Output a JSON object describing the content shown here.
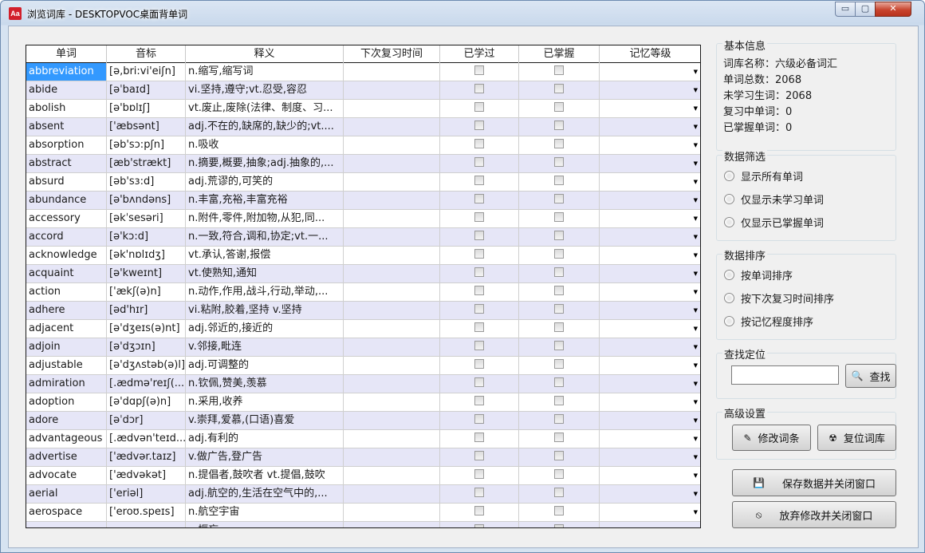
{
  "window": {
    "icon_text": "Aa",
    "title": "浏览词库 - DESKTOPVOC桌面背单词",
    "min_label": "▭",
    "max_label": "▢",
    "close_label": "✕"
  },
  "grid": {
    "columns": [
      "单词",
      "音标",
      "释义",
      "下次复习时间",
      "已学过",
      "已掌握",
      "记忆等级"
    ],
    "rows": [
      {
        "word": "abbreviation",
        "phonetic": "[ə,bri:vi'eiʃn]",
        "meaning": "n.缩写,缩写词"
      },
      {
        "word": "abide",
        "phonetic": "[əˈbaɪd]",
        "meaning": "vi.坚持,遵守;vt.忍受,容忍"
      },
      {
        "word": "abolish",
        "phonetic": "[ə'bɒlɪʃ]",
        "meaning": "vt.废止,废除(法律、制度、习..."
      },
      {
        "word": "absent",
        "phonetic": "['æbsənt]",
        "meaning": "adj.不在的,缺席的,缺少的;vt...."
      },
      {
        "word": "absorption",
        "phonetic": "[əb'sɔ:pʃn]",
        "meaning": "n.吸收"
      },
      {
        "word": "abstract",
        "phonetic": "[æb'strækt]",
        "meaning": "n.摘要,概要,抽象;adj.抽象的,..."
      },
      {
        "word": "absurd",
        "phonetic": "[əb'sɜ:d]",
        "meaning": "adj.荒谬的,可笑的"
      },
      {
        "word": "abundance",
        "phonetic": "[ə'bʌndəns]",
        "meaning": "n.丰富,充裕,丰富充裕"
      },
      {
        "word": "accessory",
        "phonetic": "[əkˈsesəri]",
        "meaning": "n.附件,零件,附加物,从犯,同..."
      },
      {
        "word": "accord",
        "phonetic": "[ə'kɔ:d]",
        "meaning": "n.一致,符合,调和,协定;vt.一..."
      },
      {
        "word": "acknowledge",
        "phonetic": "[ək'nɒlɪdʒ]",
        "meaning": "vt.承认,答谢,报偿"
      },
      {
        "word": "acquaint",
        "phonetic": "[ə'kweɪnt]",
        "meaning": "vt.使熟知,通知"
      },
      {
        "word": "action",
        "phonetic": "['ækʃ(ə)n]",
        "meaning": "n.动作,作用,战斗,行动,举动,..."
      },
      {
        "word": "adhere",
        "phonetic": "[əd'hɪr]",
        "meaning": "vi.粘附,胶着,坚持 v.坚持"
      },
      {
        "word": "adjacent",
        "phonetic": "[ə'dʒeɪs(ə)nt]",
        "meaning": "adj.邻近的,接近的"
      },
      {
        "word": "adjoin",
        "phonetic": "[ə'dʒɔɪn]",
        "meaning": "v.邻接,毗连"
      },
      {
        "word": "adjustable",
        "phonetic": "[ə'dʒʌstəb(ə)l]",
        "meaning": "adj.可调整的"
      },
      {
        "word": "admiration",
        "phonetic": "[.ædmə'reɪʃ(...",
        "meaning": "n.钦佩,赞美,羡慕"
      },
      {
        "word": "adoption",
        "phonetic": "[ə'dɑpʃ(ə)n]",
        "meaning": "n.采用,收养"
      },
      {
        "word": "adore",
        "phonetic": "[əˈdɔr]",
        "meaning": "v.崇拜,爱慕,(口语)喜爱"
      },
      {
        "word": "advantageous",
        "phonetic": "[.ædvən'teɪd...",
        "meaning": "adj.有利的"
      },
      {
        "word": "advertise",
        "phonetic": "['ædvər.taɪz]",
        "meaning": "v.做广告,登广告"
      },
      {
        "word": "advocate",
        "phonetic": "['ædvəkət]",
        "meaning": "n.提倡者,鼓吹者 vt.提倡,鼓吹"
      },
      {
        "word": "aerial",
        "phonetic": "['eriəl]",
        "meaning": "adj.航空的,生活在空气中的,..."
      },
      {
        "word": "aerospace",
        "phonetic": "['eroʊ.speɪs]",
        "meaning": "n.航空宇宙"
      },
      {
        "word": "",
        "phonetic": "",
        "meaning": "...振忘 ..."
      }
    ],
    "dropdown_glyph": "▼"
  },
  "basic_info": {
    "title": "基本信息",
    "lines": [
      "词库名称：六级必备词汇",
      "单词总数：2068",
      "未学习生词：2068",
      "复习中单词：0",
      "已掌握单词：0"
    ]
  },
  "filter": {
    "title": "数据筛选",
    "options": [
      "显示所有单词",
      "仅显示未学习单词",
      "仅显示已掌握单词"
    ]
  },
  "sort": {
    "title": "数据排序",
    "options": [
      "按单词排序",
      "按下次复习时间排序",
      "按记忆程度排序"
    ]
  },
  "search": {
    "title": "查找定位",
    "value": "",
    "button_label": "查找",
    "icon": "search-icon"
  },
  "advanced": {
    "title": "高级设置",
    "edit_label": "修改词条",
    "reset_label": "复位词库"
  },
  "actions": {
    "save_label": "保存数据并关闭窗口",
    "discard_label": "放弃修改并关闭窗口"
  }
}
